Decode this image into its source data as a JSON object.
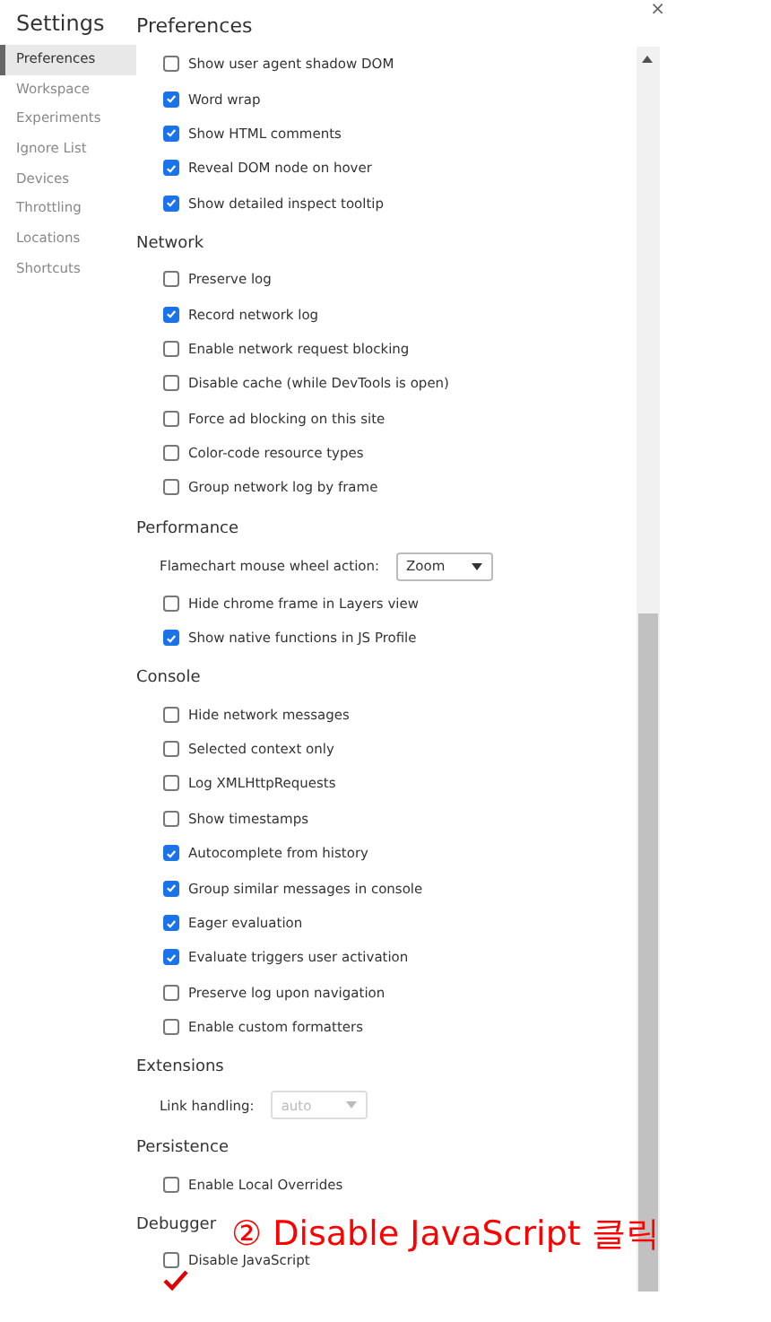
{
  "sidebar": {
    "title": "Settings",
    "items": [
      {
        "label": "Preferences",
        "selected": true
      },
      {
        "label": "Workspace",
        "selected": false
      },
      {
        "label": "Experiments",
        "selected": false
      },
      {
        "label": "Ignore List",
        "selected": false
      },
      {
        "label": "Devices",
        "selected": false
      },
      {
        "label": "Throttling",
        "selected": false
      },
      {
        "label": "Locations",
        "selected": false
      },
      {
        "label": "Shortcuts",
        "selected": false
      }
    ]
  },
  "page_title": "Preferences",
  "close": "×",
  "sections": [
    {
      "items": [
        {
          "kind": "checkbox",
          "label": "Show user agent shadow DOM",
          "checked": false
        },
        {
          "kind": "checkbox",
          "label": "Word wrap",
          "checked": true
        },
        {
          "kind": "checkbox",
          "label": "Show HTML comments",
          "checked": true
        },
        {
          "kind": "checkbox",
          "label": "Reveal DOM node on hover",
          "checked": true
        },
        {
          "kind": "checkbox",
          "label": "Show detailed inspect tooltip",
          "checked": true
        }
      ]
    },
    {
      "heading": "Network",
      "items": [
        {
          "kind": "checkbox",
          "label": "Preserve log",
          "checked": false
        },
        {
          "kind": "checkbox",
          "label": "Record network log",
          "checked": true
        },
        {
          "kind": "checkbox",
          "label": "Enable network request blocking",
          "checked": false
        },
        {
          "kind": "checkbox",
          "label": "Disable cache (while DevTools is open)",
          "checked": false
        },
        {
          "kind": "checkbox",
          "label": "Force ad blocking on this site",
          "checked": false
        },
        {
          "kind": "checkbox",
          "label": "Color-code resource types",
          "checked": false
        },
        {
          "kind": "checkbox",
          "label": "Group network log by frame",
          "checked": false
        }
      ]
    },
    {
      "heading": "Performance",
      "items": [
        {
          "kind": "select",
          "label": "Flamechart mouse wheel action:",
          "value": "Zoom",
          "disabled": false
        },
        {
          "kind": "checkbox",
          "label": "Hide chrome frame in Layers view",
          "checked": false
        },
        {
          "kind": "checkbox",
          "label": "Show native functions in JS Profile",
          "checked": true
        }
      ]
    },
    {
      "heading": "Console",
      "items": [
        {
          "kind": "checkbox",
          "label": "Hide network messages",
          "checked": false
        },
        {
          "kind": "checkbox",
          "label": "Selected context only",
          "checked": false
        },
        {
          "kind": "checkbox",
          "label": "Log XMLHttpRequests",
          "checked": false
        },
        {
          "kind": "checkbox",
          "label": "Show timestamps",
          "checked": false
        },
        {
          "kind": "checkbox",
          "label": "Autocomplete from history",
          "checked": true
        },
        {
          "kind": "checkbox",
          "label": "Group similar messages in console",
          "checked": true
        },
        {
          "kind": "checkbox",
          "label": "Eager evaluation",
          "checked": true
        },
        {
          "kind": "checkbox",
          "label": "Evaluate triggers user activation",
          "checked": true
        },
        {
          "kind": "checkbox",
          "label": "Preserve log upon navigation",
          "checked": false
        },
        {
          "kind": "checkbox",
          "label": "Enable custom formatters",
          "checked": false
        }
      ]
    },
    {
      "heading": "Extensions",
      "items": [
        {
          "kind": "select",
          "label": "Link handling:",
          "value": "auto",
          "disabled": true
        }
      ]
    },
    {
      "heading": "Persistence",
      "items": [
        {
          "kind": "checkbox",
          "label": "Enable Local Overrides",
          "checked": false
        }
      ]
    },
    {
      "heading": "Debugger",
      "items": [
        {
          "kind": "checkbox",
          "label": "Disable JavaScript",
          "checked": false
        }
      ]
    }
  ],
  "annotation": {
    "step": "②",
    "text": "Disable JavaScript 클릭"
  }
}
